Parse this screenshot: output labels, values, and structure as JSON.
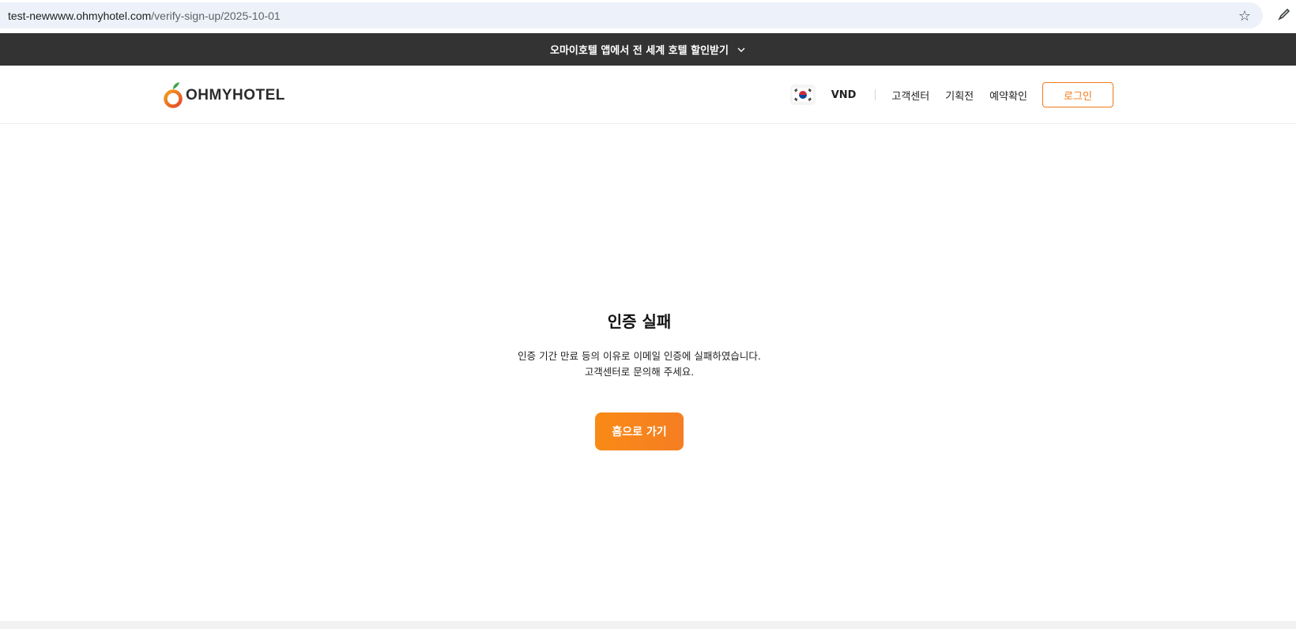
{
  "browser": {
    "url_host": "test-newwww.ohmyhotel.com",
    "url_path": "/verify-sign-up/2025-10-01"
  },
  "promo_banner": {
    "text": "오마이호텔 앱에서 전 세계 호텔 할인받기"
  },
  "header": {
    "logo_text": "OHMYHOTEL",
    "currency": "VND",
    "nav_items": [
      "고객센터",
      "기획전",
      "예약확인"
    ],
    "login_label": "로그인"
  },
  "main": {
    "title": "인증 실패",
    "description_line1": "인증 기간 만료 등의 이유로 이메일 인증에 실패하였습니다.",
    "description_line2": "고객센터로 문의해 주세요.",
    "home_button_label": "홈으로 가기"
  },
  "colors": {
    "accent": "#f07a1a",
    "banner_bg": "#333333"
  }
}
